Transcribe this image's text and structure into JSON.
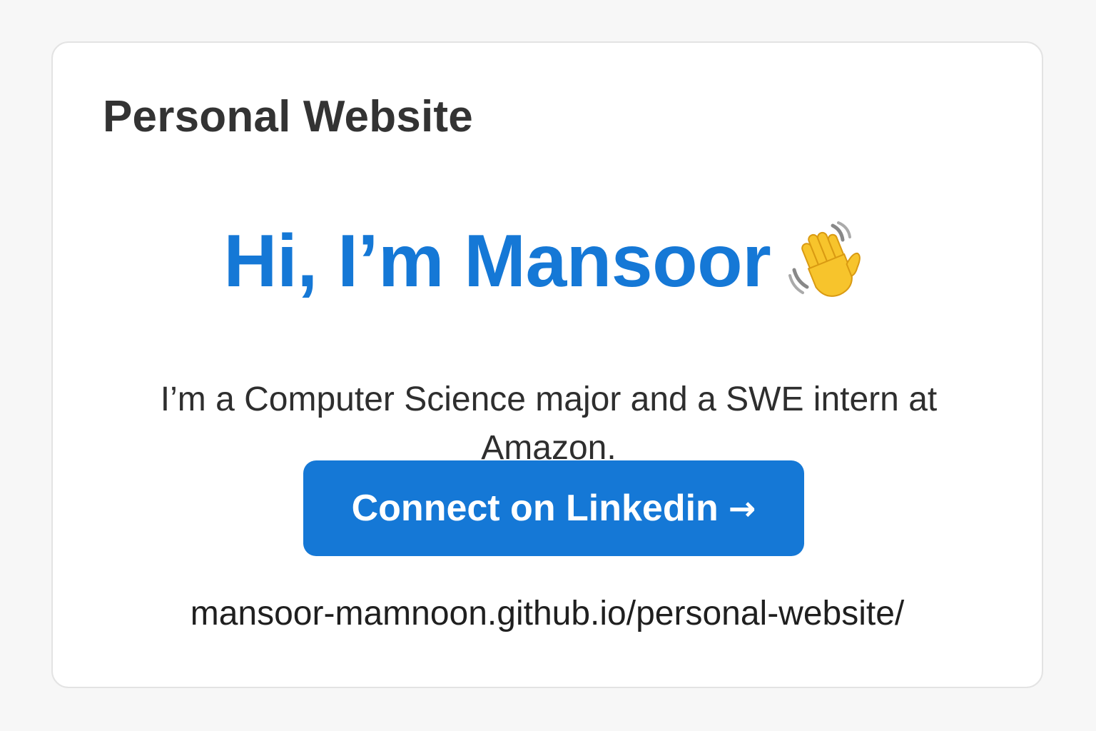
{
  "card": {
    "title": "Personal Website"
  },
  "hero": {
    "headline": "Hi, I’m Mansoor",
    "emoji_icon": "waving-hand-icon",
    "subtitle": "I’m a Computer Science major and a SWE intern at Amazon."
  },
  "cta": {
    "label": "Connect on Linkedin",
    "arrow": "→",
    "arrow_icon": "right-arrow-icon"
  },
  "footer": {
    "url": "mansoor-mamnoon.github.io/personal-website/"
  },
  "colors": {
    "accent": "#1578d6",
    "card_background": "#ffffff",
    "page_background": "#f7f7f7",
    "title_text": "#333333",
    "body_text": "#2e2e2e",
    "emoji_yellow": "#f7c42c"
  }
}
